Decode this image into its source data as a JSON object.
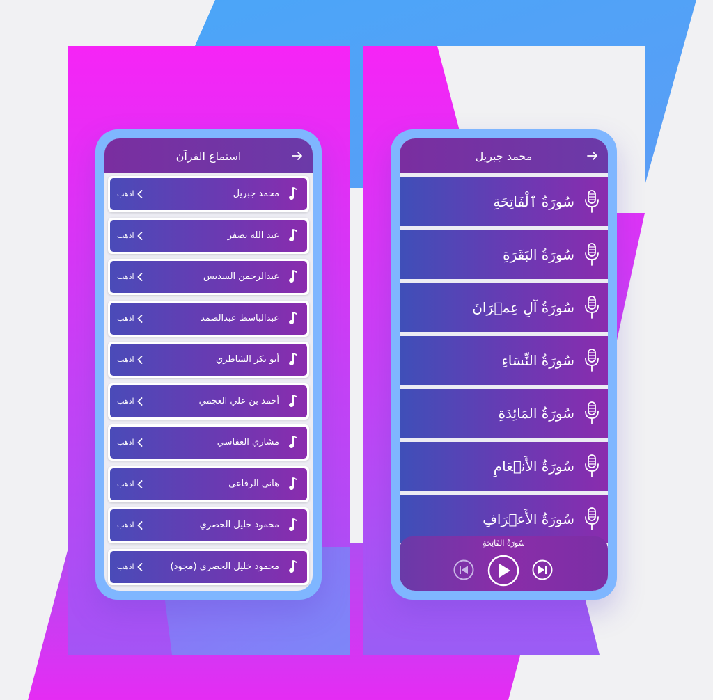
{
  "left_screen": {
    "title": "استماع القرآن",
    "go_label": "اذهب",
    "reciters": [
      {
        "name": "محمد جبريل"
      },
      {
        "name": "عبد الله بصفر"
      },
      {
        "name": "عبدالرحمن السديس"
      },
      {
        "name": "عبدالباسط عبدالصمد"
      },
      {
        "name": "أبو بكر الشاطري"
      },
      {
        "name": "أحمد بن علي العجمي"
      },
      {
        "name": "مشاري العفاسي"
      },
      {
        "name": "هاني الرفاعي"
      },
      {
        "name": "محمود خليل الحصري"
      },
      {
        "name": "محمود خليل الحصري (مجود)"
      }
    ]
  },
  "right_screen": {
    "title": "محمد جبريل",
    "surahs": [
      {
        "name": "سُورَةُ ٱلْفَاتِحَةِ"
      },
      {
        "name": "سُورَةُ البَقَرَةِ"
      },
      {
        "name": "سُورَةُ آلِ عِمۡرَانَ"
      },
      {
        "name": "سُورَةُ النِّسَاءِ"
      },
      {
        "name": "سُورَةُ المَائِدَةِ"
      },
      {
        "name": "سُورَةُ الأَنۡعَامِ"
      },
      {
        "name": "سُورَةُ الأَعۡرَافِ"
      }
    ],
    "player": {
      "now_playing": "سُورَةُ الفَاتِحَةِ"
    }
  },
  "colors": {
    "magenta": "#f81ff0",
    "blue": "#4fa9f7",
    "purple_dark": "#7a2ea0",
    "phone_frame": "#7fb6ff"
  }
}
